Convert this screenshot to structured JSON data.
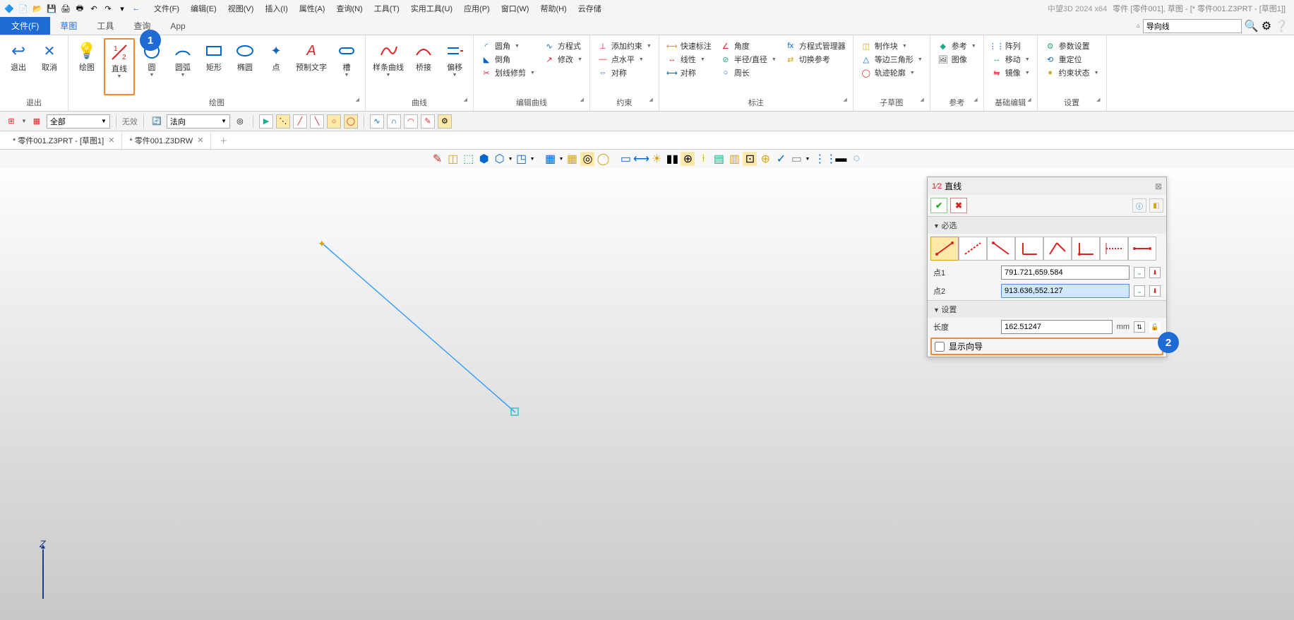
{
  "title_app": "中望3D 2024 x64",
  "title_doc": "零件 [零件001], 草图 - [* 零件001.Z3PRT - [草图1]]",
  "menus": [
    "文件(F)",
    "编辑(E)",
    "视图(V)",
    "插入(I)",
    "属性(A)",
    "查询(N)",
    "工具(T)",
    "实用工具(U)",
    "应用(P)",
    "窗口(W)",
    "帮助(H)",
    "云存储"
  ],
  "filebtn": "文件(F)",
  "tabs": [
    "草图",
    "工具",
    "查询",
    "App"
  ],
  "search_value": "导向线",
  "ribbon": {
    "exit": {
      "label": "退出",
      "items": [
        {
          "t": "退出",
          "i": "↩"
        },
        {
          "t": "取消",
          "i": "✕"
        }
      ]
    },
    "draw": {
      "label": "绘图",
      "items": [
        {
          "t": "绘图",
          "i": "💡"
        },
        {
          "t": "直线",
          "i": "1⁄2",
          "drop": true
        },
        {
          "t": "圆",
          "i": "○",
          "drop": true
        },
        {
          "t": "圆弧",
          "i": "◠",
          "drop": true
        },
        {
          "t": "矩形",
          "i": "▭"
        },
        {
          "t": "椭圆",
          "i": "⬭"
        },
        {
          "t": "点",
          "i": "✦"
        },
        {
          "t": "预制文字",
          "i": "A"
        },
        {
          "t": "槽",
          "i": "⬭",
          "drop": true
        }
      ]
    },
    "curve": {
      "label": "曲线",
      "items": [
        {
          "t": "样条曲线",
          "i": "∿",
          "drop": true
        },
        {
          "t": "桥接",
          "i": "∩"
        },
        {
          "t": "偏移",
          "i": "⇢",
          "drop": true
        }
      ]
    },
    "editcurve": {
      "label": "编辑曲线",
      "small": [
        {
          "t": "圆角",
          "i": "◜",
          "drop": true
        },
        {
          "t": "倒角",
          "i": "◣"
        },
        {
          "t": "划线修剪",
          "i": "✂",
          "drop": true
        }
      ],
      "small2": [
        {
          "t": "方程式",
          "i": "∿"
        },
        {
          "t": "修改",
          "i": "↗",
          "drop": true
        }
      ]
    },
    "constraint": {
      "label": "约束",
      "small": [
        {
          "t": "添加约束",
          "i": "⊥",
          "drop": true
        },
        {
          "t": "点水平",
          "i": "·—",
          "drop": true
        },
        {
          "t": "对称",
          "i": "⇔"
        }
      ]
    },
    "dim": {
      "label": "标注",
      "small": [
        {
          "t": "快速标注",
          "i": "⟷"
        },
        {
          "t": "线性",
          "i": "↔",
          "drop": true
        },
        {
          "t": "对称",
          "i": "⟷"
        }
      ],
      "small2": [
        {
          "t": "角度",
          "i": "∠"
        },
        {
          "t": "半径/直径",
          "i": "⊘",
          "drop": true
        },
        {
          "t": "周长",
          "i": "○"
        }
      ],
      "small3": [
        {
          "t": "方程式管理器",
          "i": "fx"
        },
        {
          "t": "切换参考",
          "i": "⇄"
        }
      ]
    },
    "sub": {
      "label": "子草图",
      "small": [
        {
          "t": "制作块",
          "i": "◫",
          "drop": true
        },
        {
          "t": "等边三角形",
          "i": "△",
          "drop": true
        },
        {
          "t": "轨迹轮廓",
          "i": "◯",
          "drop": true
        }
      ]
    },
    "ref": {
      "label": "参考",
      "small": [
        {
          "t": "参考",
          "i": "◆",
          "drop": true
        },
        {
          "t": "图像",
          "i": "🖼"
        }
      ]
    },
    "edit": {
      "label": "基础编辑",
      "small": [
        {
          "t": "阵列",
          "i": "⋮⋮"
        },
        {
          "t": "移动",
          "i": "↔",
          "drop": true
        },
        {
          "t": "镜像",
          "i": "⇋",
          "drop": true
        }
      ]
    },
    "settings": {
      "label": "设置",
      "small": [
        {
          "t": "参数设置",
          "i": "⚙"
        },
        {
          "t": "重定位",
          "i": "⟲"
        },
        {
          "t": "约束状态",
          "i": "●",
          "drop": true
        }
      ]
    }
  },
  "toolbar2": {
    "combo1": "全部",
    "state": "无效",
    "combo2": "法向"
  },
  "doctabs": [
    {
      "t": "* 零件001.Z3PRT - [草图1]",
      "close": true
    },
    {
      "t": "* 零件001.Z3DRW",
      "close": true
    }
  ],
  "panel": {
    "title": "直线",
    "sect1": "必选",
    "pt1_label": "点1",
    "pt1_value": "791.721,659.584",
    "pt2_label": "点2",
    "pt2_value": "913.636,552.127",
    "sect2": "设置",
    "len_label": "长度",
    "len_value": "162.51247",
    "len_unit": "mm",
    "guide_label": "显示向导"
  },
  "callouts": {
    "c1": "1",
    "c2": "2"
  },
  "axis_z": "Z"
}
